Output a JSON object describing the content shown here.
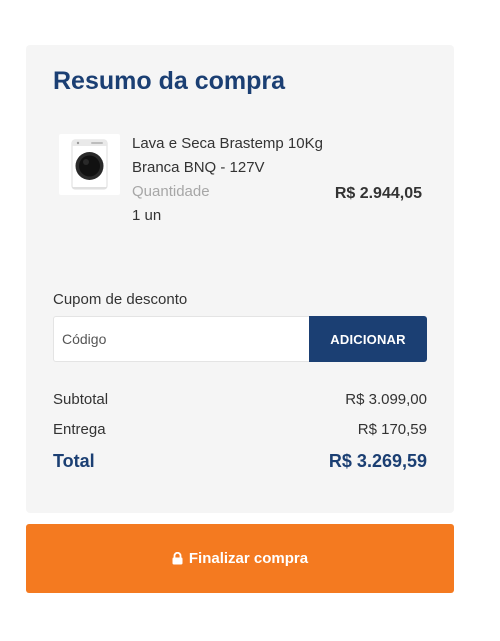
{
  "summary": {
    "title": "Resumo da compra"
  },
  "product": {
    "name": "Lava e Seca Brastemp 10Kg Branca BNQ - 127V",
    "quantity_label": "Quantidade",
    "quantity_value": "1 un",
    "price": "R$ 2.944,05",
    "thumbnail_icon": "washer-dryer-image"
  },
  "coupon": {
    "label": "Cupom de desconto",
    "placeholder": "Código",
    "value": "",
    "button_label": "ADICIONAR"
  },
  "totals": {
    "subtotal_label": "Subtotal",
    "subtotal_value": "R$ 3.099,00",
    "shipping_label": "Entrega",
    "shipping_value": "R$ 170,59",
    "total_label": "Total",
    "total_value": "R$ 3.269,59"
  },
  "checkout": {
    "button_label": "Finalizar compra",
    "icon": "lock-icon"
  },
  "colors": {
    "primary": "#1b3f73",
    "accent": "#f47a20",
    "card_background": "#f5f5f5"
  }
}
